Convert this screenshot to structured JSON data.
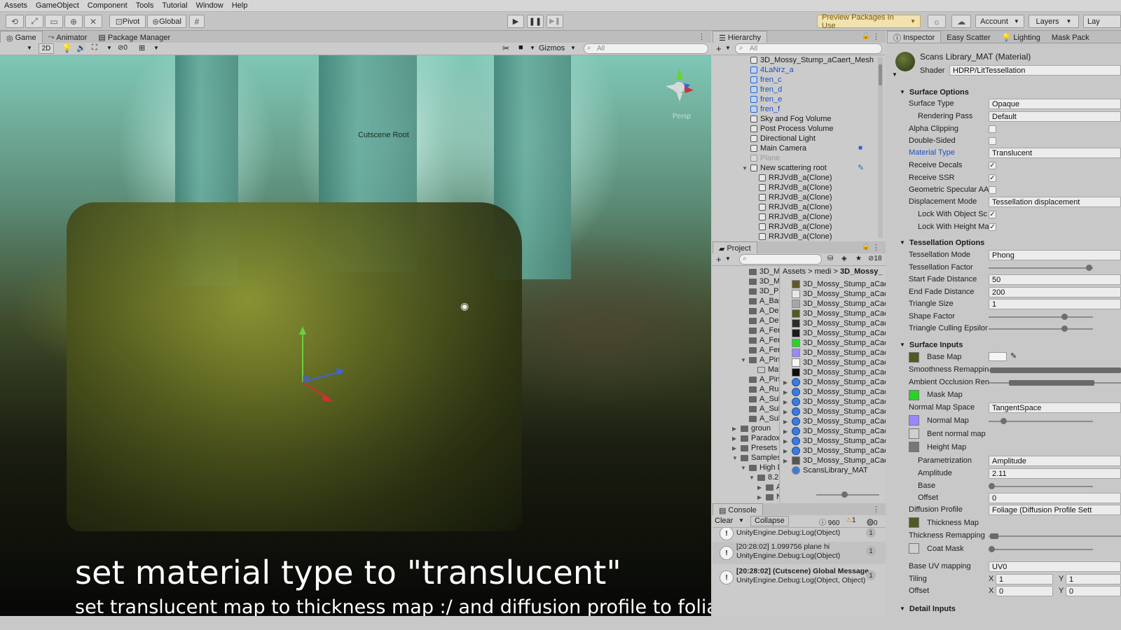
{
  "menu": [
    "Assets",
    "GameObject",
    "Component",
    "Tools",
    "Tutorial",
    "Window",
    "Help"
  ],
  "toolbar": {
    "pivot": "Pivot",
    "global": "Global",
    "preview_packages": "Preview Packages In Use",
    "account": "Account",
    "layers": "Layers",
    "layout": "Lay"
  },
  "game_panel": {
    "tabs": [
      "Game",
      "Animator",
      "Package Manager"
    ],
    "mode_2d": "2D",
    "gizmos": "Gizmos",
    "search_placeholder": "All",
    "fx_count": "0",
    "cutscene_label": "Cutscene Root",
    "persp_label": "Persp"
  },
  "captions": {
    "line1": "set material type to \"translucent\"",
    "line2": "set translucent map to thickness map  :/  and diffusion profile to foliage"
  },
  "hierarchy": {
    "title": "Hierarchy",
    "search_placeholder": "All",
    "items": [
      {
        "label": "3D_Mossy_Stump_aCaert_Mesh",
        "style": "normal"
      },
      {
        "label": "4LaNrz_a",
        "style": "blue"
      },
      {
        "label": "fren_c",
        "style": "blue"
      },
      {
        "label": "fren_d",
        "style": "blue"
      },
      {
        "label": "fren_e",
        "style": "blue"
      },
      {
        "label": "fren_f",
        "style": "blue"
      },
      {
        "label": "Sky and Fog Volume",
        "style": "normal"
      },
      {
        "label": "Post Process Volume",
        "style": "normal"
      },
      {
        "label": "Directional Light",
        "style": "normal"
      },
      {
        "label": "Main Camera",
        "style": "normal"
      },
      {
        "label": "Plane",
        "style": "grey"
      },
      {
        "label": "New scattering root",
        "style": "normal"
      },
      {
        "label": "RRJVdB_a(Clone)",
        "style": "child"
      },
      {
        "label": "RRJVdB_a(Clone)",
        "style": "child"
      },
      {
        "label": "RRJVdB_a(Clone)",
        "style": "child"
      },
      {
        "label": "RRJVdB_a(Clone)",
        "style": "child"
      },
      {
        "label": "RRJVdB_a(Clone)",
        "style": "child"
      },
      {
        "label": "RRJVdB_a(Clone)",
        "style": "child"
      },
      {
        "label": "RRJVdB_a(Clone)",
        "style": "child"
      }
    ]
  },
  "project": {
    "title": "Project",
    "count": "18",
    "breadcrumb": [
      "Assets",
      "medi",
      "3D_Mossy_"
    ],
    "folders": [
      "3D_M",
      "3D_M",
      "3D_Pl",
      "A_Barl",
      "A_Dea",
      "A_Dea",
      "A_Ferr",
      "A_Ferr",
      "A_Ferr",
      "A_Pine",
      "Mat",
      "A_Pine",
      "A_Rub",
      "A_Sub",
      "A_Sub",
      "A_Sub",
      "groun",
      "Paradoxl",
      "Presets",
      "Samples",
      "High D",
      "8.2.",
      "A",
      "N"
    ],
    "assets": [
      {
        "label": "3D_Mossy_Stump_aCae",
        "color": "#5b5a2a"
      },
      {
        "label": "3D_Mossy_Stump_aCae",
        "color": "#e7e7e7"
      },
      {
        "label": "3D_Mossy_Stump_aCae",
        "color": "#a6a6a6"
      },
      {
        "label": "3D_Mossy_Stump_aCae",
        "color": "#4e5b26"
      },
      {
        "label": "3D_Mossy_Stump_aCae",
        "color": "#2b2b2b"
      },
      {
        "label": "3D_Mossy_Stump_aCae",
        "color": "#1b1b1b"
      },
      {
        "label": "3D_Mossy_Stump_aCae",
        "color": "#2ad12a"
      },
      {
        "label": "3D_Mossy_Stump_aCae",
        "color": "#9a86ff"
      },
      {
        "label": "3D_Mossy_Stump_aCae",
        "color": "#f5f5f5"
      },
      {
        "label": "3D_Mossy_Stump_aCae",
        "color": "#0e0e0e"
      },
      {
        "label": "3D_Mossy_Stump_aCae",
        "color": "mesh"
      },
      {
        "label": "3D_Mossy_Stump_aCae",
        "color": "mesh"
      },
      {
        "label": "3D_Mossy_Stump_aCae",
        "color": "mesh"
      },
      {
        "label": "3D_Mossy_Stump_aCae",
        "color": "mesh"
      },
      {
        "label": "3D_Mossy_Stump_aCae",
        "color": "mesh"
      },
      {
        "label": "3D_Mossy_Stump_aCae",
        "color": "mesh"
      },
      {
        "label": "3D_Mossy_Stump_aCae",
        "color": "mesh"
      },
      {
        "label": "3D_Mossy_Stump_aCae",
        "color": "mesh"
      },
      {
        "label": "3D_Mossy_Stump_aCae",
        "color": "prefab"
      },
      {
        "label": "ScansLibrary_MAT",
        "color": "material"
      }
    ]
  },
  "console": {
    "title": "Console",
    "clear": "Clear",
    "collapse": "Collapse",
    "log_count": "960",
    "warn_count": "1",
    "error_count": "0",
    "entries": [
      {
        "line1": "UnityEngine.Debug:Log(Object)",
        "line2": "",
        "count": "1"
      },
      {
        "line1": "[20:28:02] 1.099756 plane hi",
        "line2": "UnityEngine.Debug:Log(Object)",
        "count": "1"
      },
      {
        "line1": "[20:28:02] (Cutscene) Global Message",
        "line2": "UnityEngine.Debug:Log(Object, Object)",
        "count": "1"
      }
    ]
  },
  "inspector": {
    "tabs": [
      "Inspector",
      "Easy Scatter",
      "Lighting",
      "Mask Pack"
    ],
    "material_name": "Scans Library_MAT (Material)",
    "shader_label": "Shader",
    "shader_value": "HDRP/LitTessellation",
    "surface_options": {
      "title": "Surface Options",
      "surface_type_label": "Surface Type",
      "surface_type": "Opaque",
      "rendering_pass_label": "Rendering Pass",
      "rendering_pass": "Default",
      "alpha_clipping_label": "Alpha Clipping",
      "double_sided_label": "Double-Sided",
      "material_type_label": "Material Type",
      "material_type": "Translucent",
      "receive_decals_label": "Receive Decals",
      "receive_ssr_label": "Receive SSR",
      "geo_specular_label": "Geometric Specular AA",
      "displacement_label": "Displacement Mode",
      "displacement": "Tessellation displacement",
      "lock_object_label": "Lock With Object Sc",
      "lock_height_label": "Lock With Height Ma"
    },
    "tessellation": {
      "title": "Tessellation Options",
      "mode_label": "Tessellation Mode",
      "mode": "Phong",
      "factor_label": "Tessellation Factor",
      "start_fade_label": "Start Fade Distance",
      "start_fade": "50",
      "end_fade_label": "End Fade Distance",
      "end_fade": "200",
      "triangle_size_label": "Triangle Size",
      "triangle_size": "1",
      "shape_factor_label": "Shape Factor",
      "culling_label": "Triangle Culling Epsilor"
    },
    "surface_inputs": {
      "title": "Surface Inputs",
      "base_map_label": "Base Map",
      "smoothness_label": "Smoothness Remappin",
      "ao_label": "Ambient Occlusion Ren",
      "mask_map_label": "Mask Map",
      "normal_space_label": "Normal Map Space",
      "normal_space": "TangentSpace",
      "normal_map_label": "Normal Map",
      "bent_normal_label": "Bent normal map",
      "height_map_label": "Height Map",
      "parametrization_label": "Parametrization",
      "parametrization": "Amplitude",
      "amplitude_label": "Amplitude",
      "amplitude": "2.11",
      "base_label": "Base",
      "offset_label": "Offset",
      "offset": "0",
      "diffusion_label": "Diffusion Profile",
      "diffusion": "Foliage (Diffusion Profile Sett",
      "thickness_label": "Thickness Map",
      "thickness_remap_label": "Thickness Remapping",
      "coat_mask_label": "Coat Mask",
      "base_uv_label": "Base UV mapping",
      "base_uv": "UV0",
      "tiling_label": "Tiling",
      "tiling_x": "1",
      "tiling_y": "1",
      "offset2_label": "Offset",
      "offset_x": "0",
      "offset_y": "0"
    },
    "detail_inputs_title": "Detail Inputs"
  }
}
